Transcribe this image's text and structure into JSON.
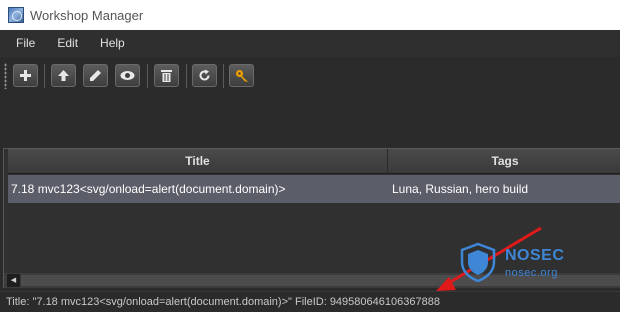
{
  "window": {
    "title": "Workshop Manager"
  },
  "menu": {
    "file": "File",
    "edit": "Edit",
    "help": "Help"
  },
  "toolbar": {
    "add_icon": "plus-icon",
    "upload_icon": "upload-icon",
    "edit_icon": "pencil-icon",
    "view_icon": "eye-icon",
    "delete_icon": "trash-icon",
    "refresh_icon": "refresh-icon",
    "key_icon": "key-icon",
    "key_color": "#f0a000"
  },
  "grid": {
    "columns": [
      "Title",
      "Tags"
    ],
    "rows": [
      {
        "title": "7.18 mvc123<svg/onload=alert(document.domain)>",
        "tags": "Luna, Russian, hero build"
      }
    ],
    "selected_row_color": "#5b5e69"
  },
  "status": {
    "text": "Title: \"7.18 mvc123<svg/onload=alert(document.domain)>\" FileID: 949580646106367888"
  },
  "watermark": {
    "brand": "NOSEC",
    "domain": "nosec.org",
    "color": "#3e86d6"
  },
  "annotation": {
    "arrow_color": "#e01a1a"
  }
}
